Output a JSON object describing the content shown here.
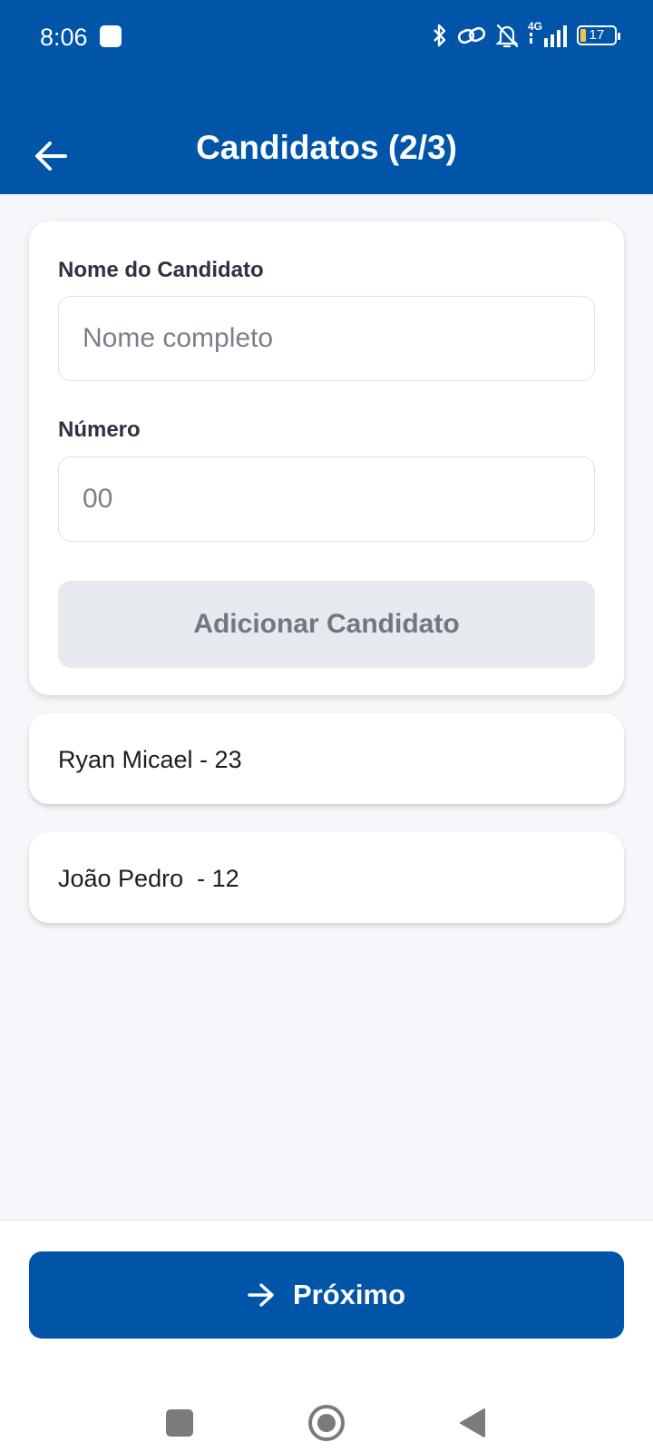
{
  "status_bar": {
    "time": "8:06",
    "network": "4G",
    "battery": "17",
    "icons": [
      "bluetooth-icon",
      "link-icon",
      "bell-off-icon",
      "signal-icon",
      "battery-icon"
    ]
  },
  "header": {
    "title": "Candidatos (2/3)",
    "back_icon": "arrow-left-icon",
    "background": "#0055a8"
  },
  "form": {
    "name_label": "Nome do Candidato",
    "name_placeholder": "Nome completo",
    "name_value": "",
    "number_label": "Número",
    "number_placeholder": "00",
    "number_value": "",
    "add_button_label": "Adicionar Candidato"
  },
  "candidates": [
    {
      "label": "Ryan Micael - 23"
    },
    {
      "label": "João Pedro  - 12"
    }
  ],
  "footer": {
    "next_button_label": "Próximo",
    "next_icon": "arrow-right-icon"
  },
  "colors": {
    "primary": "#0055a8",
    "disabled_button": "#e6e9ee",
    "disabled_text": "#707684",
    "background": "#f5f7fa"
  }
}
